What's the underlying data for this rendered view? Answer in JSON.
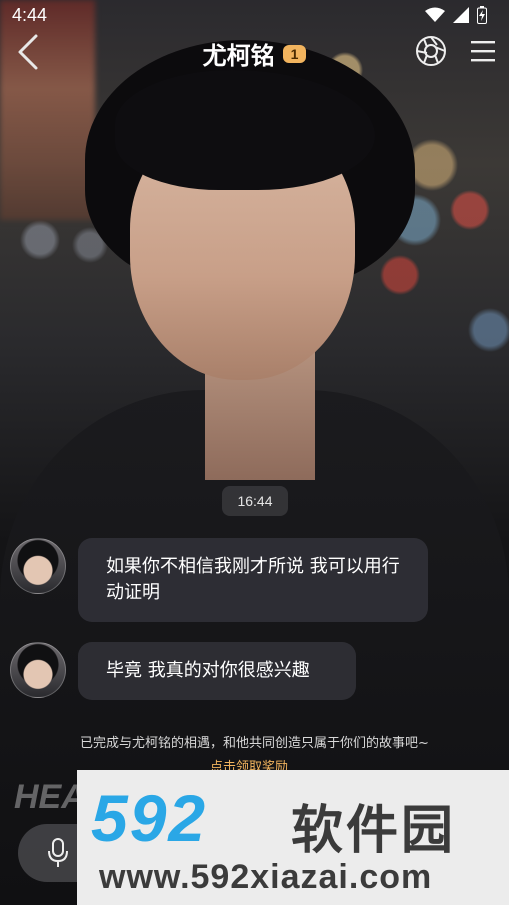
{
  "status_bar": {
    "time": "4:44"
  },
  "header": {
    "title": "尤柯铭",
    "badge": "1"
  },
  "chat": {
    "timestamp": "16:44",
    "messages": [
      {
        "text": "如果你不相信我刚才所说 我可以用行动证明"
      },
      {
        "text": "毕竟 我真的对你很感兴趣"
      }
    ]
  },
  "notice": {
    "text": "已完成与尤柯铭的相遇，和他共同创造只属于你们的故事吧~",
    "link": "点击领取奖励"
  },
  "background": {
    "shirt_text": "HEA"
  },
  "watermark": {
    "logo_number": "592",
    "logo_text": "软件园",
    "url": "www.592xiazai.com"
  },
  "colors": {
    "accent": "#f2b45e",
    "bubble": "#303036",
    "watermark_blue": "#2aa7e6"
  },
  "icons": [
    "wifi-icon",
    "signal-icon",
    "battery-icon",
    "back-icon",
    "camera-shutter-icon",
    "menu-icon",
    "mic-icon"
  ]
}
